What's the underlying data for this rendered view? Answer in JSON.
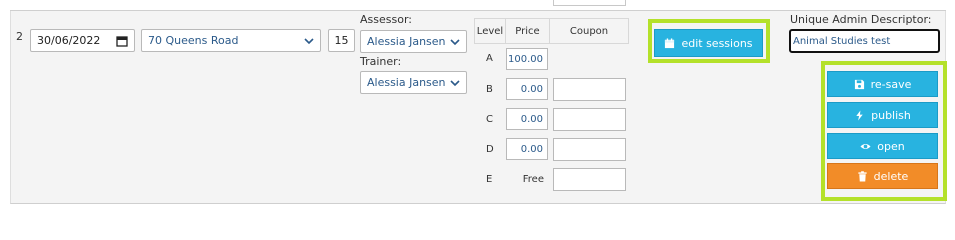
{
  "row": {
    "number": "2",
    "date": "30/06/2022",
    "venue": "70 Queens Road",
    "quantity": "15",
    "assessor_label": "Assessor:",
    "assessor": "Alessia Jansen",
    "trainer_label": "Trainer:",
    "trainer": "Alessia Jansen"
  },
  "pricing": {
    "headers": {
      "level": "Level",
      "price": "Price",
      "coupon": "Coupon"
    },
    "rows": [
      {
        "level": "A",
        "price": "100.00",
        "coupon": ""
      },
      {
        "level": "B",
        "price": "0.00",
        "coupon": ""
      },
      {
        "level": "C",
        "price": "0.00",
        "coupon": ""
      },
      {
        "level": "D",
        "price": "0.00",
        "coupon": ""
      },
      {
        "level": "E",
        "price": "Free",
        "coupon": ""
      }
    ]
  },
  "actions": {
    "edit_sessions": "edit sessions",
    "resave": "re-save",
    "publish": "publish",
    "open": "open",
    "delete": "delete"
  },
  "descriptor": {
    "label": "Unique Admin Descriptor:",
    "value": "Animal Studies test"
  },
  "colors": {
    "primary_button": "#28b3e0",
    "delete_button": "#f28c28",
    "highlight": "#b4e12a",
    "row_background": "#f4f4f4",
    "value_text": "#2b5a8a"
  }
}
